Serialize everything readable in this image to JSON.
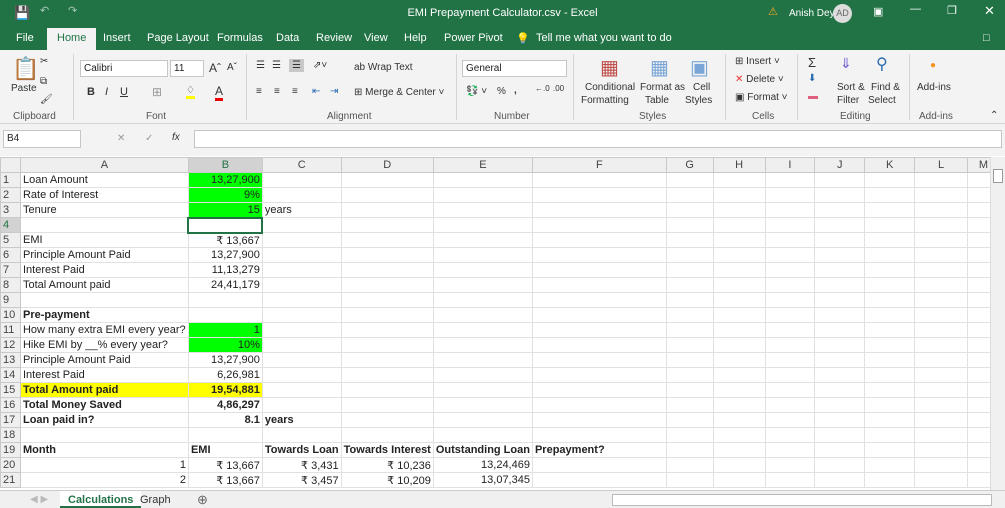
{
  "window": {
    "title": "EMI Prepayment Calculator.csv  -  Excel",
    "user": "Anish Dey",
    "initials": "AD"
  },
  "tabs": [
    "File",
    "Home",
    "Insert",
    "Page Layout",
    "Formulas",
    "Data",
    "Review",
    "View",
    "Help",
    "Power Pivot"
  ],
  "tell_me": "Tell me what you want to do",
  "ribbon": {
    "paste": "Paste",
    "font": "Calibri",
    "size": "11",
    "wrap": "Wrap Text",
    "merge": "Merge & Center",
    "number_format": "General",
    "cond1": "Conditional",
    "cond2": "Formatting",
    "fmt1": "Format as",
    "fmt2": "Table",
    "cell1": "Cell",
    "cell2": "Styles",
    "insert": "Insert",
    "delete": "Delete",
    "format": "Format",
    "sort1": "Sort &",
    "sort2": "Filter",
    "find1": "Find &",
    "find2": "Select",
    "addins": "Add-ins",
    "groups": {
      "clipboard": "Clipboard",
      "font": "Font",
      "alignment": "Alignment",
      "number": "Number",
      "styles": "Styles",
      "cells": "Cells",
      "editing": "Editing",
      "addins": "Add-ins"
    }
  },
  "namebox": "B4",
  "fx": "fx",
  "columns": [
    "A",
    "B",
    "C",
    "D",
    "E",
    "F",
    "G",
    "H",
    "I",
    "J",
    "K",
    "L",
    "M"
  ],
  "rows": [
    [
      "Loan Amount",
      "13,27,900",
      "",
      "",
      "",
      "",
      ""
    ],
    [
      "Rate of Interest",
      "9%",
      "",
      "",
      "",
      "",
      ""
    ],
    [
      "Tenure",
      "15",
      "years",
      "",
      "",
      "",
      ""
    ],
    [
      "",
      "",
      "",
      "",
      "",
      "",
      ""
    ],
    [
      "EMI",
      "₹ 13,667",
      "",
      "",
      "",
      "",
      ""
    ],
    [
      "Principle Amount Paid",
      "13,27,900",
      "",
      "",
      "",
      "",
      ""
    ],
    [
      "Interest Paid",
      "11,13,279",
      "",
      "",
      "",
      "",
      ""
    ],
    [
      "Total Amount paid",
      "24,41,179",
      "",
      "",
      "",
      "",
      ""
    ],
    [
      "",
      "",
      "",
      "",
      "",
      "",
      ""
    ],
    [
      "Pre-payment",
      "",
      "",
      "",
      "",
      "",
      ""
    ],
    [
      "How many extra EMI every year?",
      "1",
      "",
      "",
      "",
      "",
      ""
    ],
    [
      "Hike EMI by __% every year?",
      "10%",
      "",
      "",
      "",
      "",
      ""
    ],
    [
      "Principle Amount Paid",
      "13,27,900",
      "",
      "",
      "",
      "",
      ""
    ],
    [
      "Interest Paid",
      "6,26,981",
      "",
      "",
      "",
      "",
      ""
    ],
    [
      "Total Amount paid",
      "19,54,881",
      "",
      "",
      "",
      "",
      ""
    ],
    [
      "Total Money Saved",
      "4,86,297",
      "",
      "",
      "",
      "",
      ""
    ],
    [
      "Loan paid in?",
      "8.1",
      "years",
      "",
      "",
      "",
      ""
    ],
    [
      "",
      "",
      "",
      "",
      "",
      "",
      ""
    ],
    [
      "Month",
      "EMI",
      "Towards Loan",
      "Towards Interest",
      "Outstanding Loan",
      "Prepayment?",
      ""
    ],
    [
      "1",
      "₹ 13,667",
      "₹ 3,431",
      "₹ 10,236",
      "13,24,469",
      "",
      ""
    ],
    [
      "2",
      "₹ 13,667",
      "₹ 3,457",
      "₹ 10,209",
      "13,07,345",
      "",
      ""
    ]
  ],
  "sheets": [
    "Calculations",
    "Graph"
  ],
  "colors": {
    "excel_green": "#217346",
    "input_green": "#00ff00",
    "highlight": "#ffff00"
  }
}
